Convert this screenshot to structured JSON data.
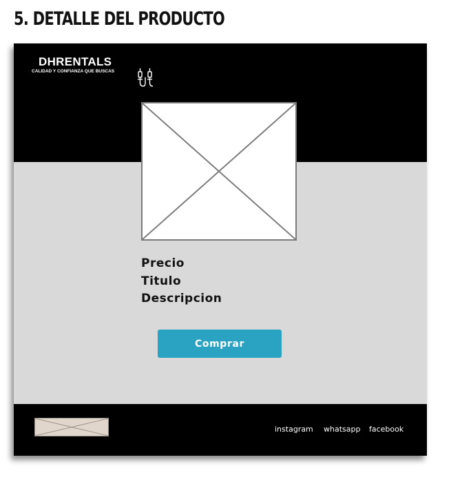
{
  "page_heading": "5. DETALLE DEL PRODUCTO",
  "brand": {
    "name": "DHRENTALS",
    "tagline": "CALIDAD Y CONFIANZA QUE BUSCAS",
    "icon": "audio-cable-icon"
  },
  "product": {
    "image": "image-placeholder",
    "price_label": "Precio",
    "title_label": "Titulo",
    "description_label": "Descripcion"
  },
  "actions": {
    "buy_label": "Comprar"
  },
  "footer": {
    "image": "image-placeholder",
    "links": [
      "instagram",
      "whatsapp",
      "facebook"
    ]
  },
  "colors": {
    "header_bg": "#000000",
    "body_bg": "#d9d9d9",
    "button_bg": "#29a3c1",
    "button_text": "#ffffff"
  }
}
